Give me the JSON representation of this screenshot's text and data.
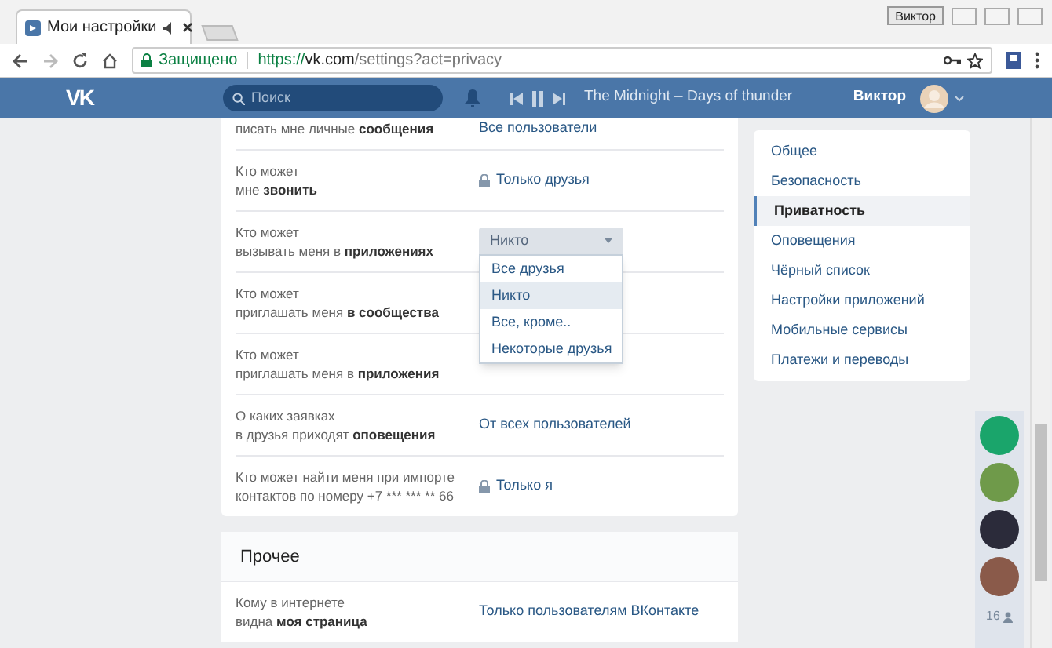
{
  "browser": {
    "profile": "Виктор",
    "tab": {
      "title": "Мои настройки"
    },
    "address": {
      "secure_label": "Защищено",
      "scheme": "https://",
      "host": "vk.com",
      "path": "/settings?act=privacy"
    }
  },
  "header": {
    "logo": "VK",
    "search": {
      "placeholder": "Поиск"
    },
    "track": "The Midnight – Days of thunder",
    "user": "Виктор"
  },
  "privacy": {
    "rows": [
      {
        "label": [
          "писать мне личные **сообщения**"
        ],
        "value": "Все пользователи",
        "locked": false
      },
      {
        "label": [
          "Кто может",
          "мне **звонить**"
        ],
        "value": "Только друзья",
        "locked": true
      },
      {
        "label": [
          "Кто может",
          "вызывать меня в **приложениях**"
        ],
        "kind": "dropdown"
      },
      {
        "label": [
          "Кто может",
          "приглашать меня **в сообщества**"
        ]
      },
      {
        "label": [
          "Кто может",
          "приглашать меня в **приложения**"
        ]
      },
      {
        "label": [
          "О каких заявках",
          "в друзья приходят **оповещения**"
        ],
        "value": "От всех пользователей",
        "locked": false
      },
      {
        "label": [
          "Кто может найти меня при импорте",
          [
            {
              "text": "контактов по номеру +7 *** *** ** 66",
              "bold": false
            }
          ]
        ],
        "value": "Только я",
        "locked": true
      }
    ]
  },
  "dropdown": {
    "value": "Никто",
    "options": [
      {
        "label": "Все друзья",
        "selected": false
      },
      {
        "label": "Никто",
        "selected": true
      },
      {
        "label": "Все, кроме..",
        "selected": false
      },
      {
        "label": "Некоторые друзья",
        "selected": false
      }
    ]
  },
  "other": {
    "title": "Прочее",
    "rows": [
      {
        "label": [
          "Кому в интернете",
          "видна **моя страница**"
        ],
        "value": "Только пользователям ВКонтакте",
        "locked": false
      }
    ]
  },
  "menu": [
    {
      "label": "Общее",
      "selected": false
    },
    {
      "label": "Безопасность",
      "selected": false
    },
    {
      "label": "Приватность",
      "selected": true
    },
    {
      "label": "Оповещения",
      "selected": false
    },
    {
      "label": "Чёрный список",
      "selected": false
    },
    {
      "label": "Настройки приложений",
      "selected": false
    },
    {
      "label": "Мобильные сервисы",
      "selected": false
    },
    {
      "label": "Платежи и переводы",
      "selected": false
    }
  ],
  "chats": {
    "count": "16"
  }
}
